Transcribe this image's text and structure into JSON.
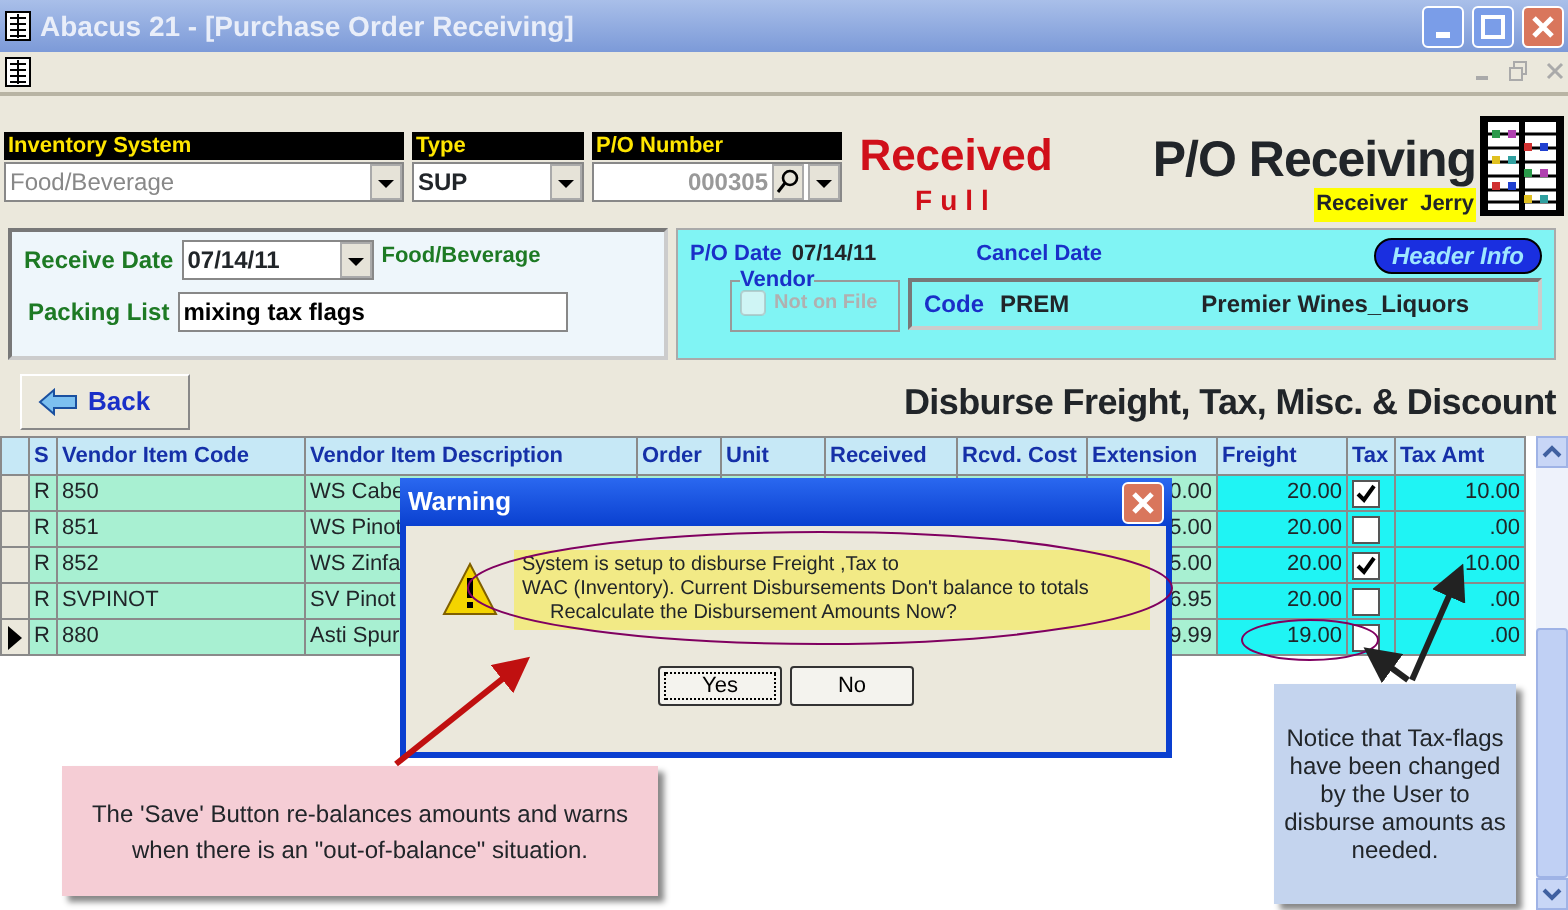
{
  "window": {
    "title": "Abacus 21 - [Purchase Order Receiving]"
  },
  "header": {
    "inventory_label": "Inventory System",
    "inventory_value": "Food/Beverage",
    "type_label": "Type",
    "type_value": "SUP",
    "po_label": "P/O Number",
    "po_value": "000305",
    "status": "Received",
    "status_detail": "Full",
    "screen_title": "P/O Receiving",
    "receiver": "Receiver  Jerry"
  },
  "receiving": {
    "receive_date_label": "Receive Date",
    "receive_date": "07/14/11",
    "inventory_system": "Food/Beverage",
    "packing_list_label": "Packing List",
    "packing_list": "mixing tax flags"
  },
  "po_info": {
    "po_date_label": "P/O Date",
    "po_date": "07/14/11",
    "cancel_date_label": "Cancel Date",
    "header_info_button": "Header Info",
    "vendor_group": "Vendor",
    "not_on_file": {
      "label": "Not on File",
      "checked": false,
      "disabled": true
    },
    "code_label": "Code",
    "code": "PREM",
    "vendor_name": "Premier Wines_Liquors"
  },
  "back_button": "Back",
  "section_title": "Disburse Freight, Tax, Misc. & Discount",
  "grid": {
    "columns": [
      "S",
      "Vendor Item Code",
      "Vendor Item Description",
      "Order",
      "Unit",
      "Received",
      "Rcvd. Cost",
      "Extension",
      "Freight",
      "Tax",
      "Tax Amt"
    ],
    "rows": [
      {
        "current": false,
        "status": "R",
        "code": "850",
        "description": "WS Cabe",
        "extension": "0.00",
        "freight": "20.00",
        "tax": true,
        "tax_amt": "10.00"
      },
      {
        "current": false,
        "status": "R",
        "code": "851",
        "description": "WS Pinot",
        "extension": "5.00",
        "freight": "20.00",
        "tax": false,
        "tax_amt": ".00"
      },
      {
        "current": false,
        "status": "R",
        "code": "852",
        "description": "WS Zinfa",
        "extension": "5.00",
        "freight": "20.00",
        "tax": true,
        "tax_amt": "10.00"
      },
      {
        "current": false,
        "status": "R",
        "code": "SVPINOT",
        "description": "SV Pinot",
        "extension": "6.95",
        "freight": "20.00",
        "tax": false,
        "tax_amt": ".00"
      },
      {
        "current": true,
        "status": "R",
        "code": "880",
        "description": "Asti Spur",
        "extension": "9.99",
        "freight": "19.00",
        "tax": false,
        "tax_amt": ".00"
      }
    ]
  },
  "dialog": {
    "title": "Warning",
    "message_lines": [
      "System is setup to disburse Freight ,Tax to",
      "WAC (Inventory). Current Disbursements Don't balance to totals",
      "Recalculate the Disbursement Amounts Now?"
    ],
    "buttons": [
      {
        "label": "Yes",
        "focused": true
      },
      {
        "label": "No",
        "focused": false
      }
    ]
  },
  "callouts": [
    {
      "kind": "pink",
      "text": "The 'Save' Button re-balances amounts and warns when there is an \"out-of-balance\" situation."
    },
    {
      "kind": "blue",
      "text": "Notice that Tax-flags have been changed by the User to disburse amounts as needed."
    }
  ]
}
